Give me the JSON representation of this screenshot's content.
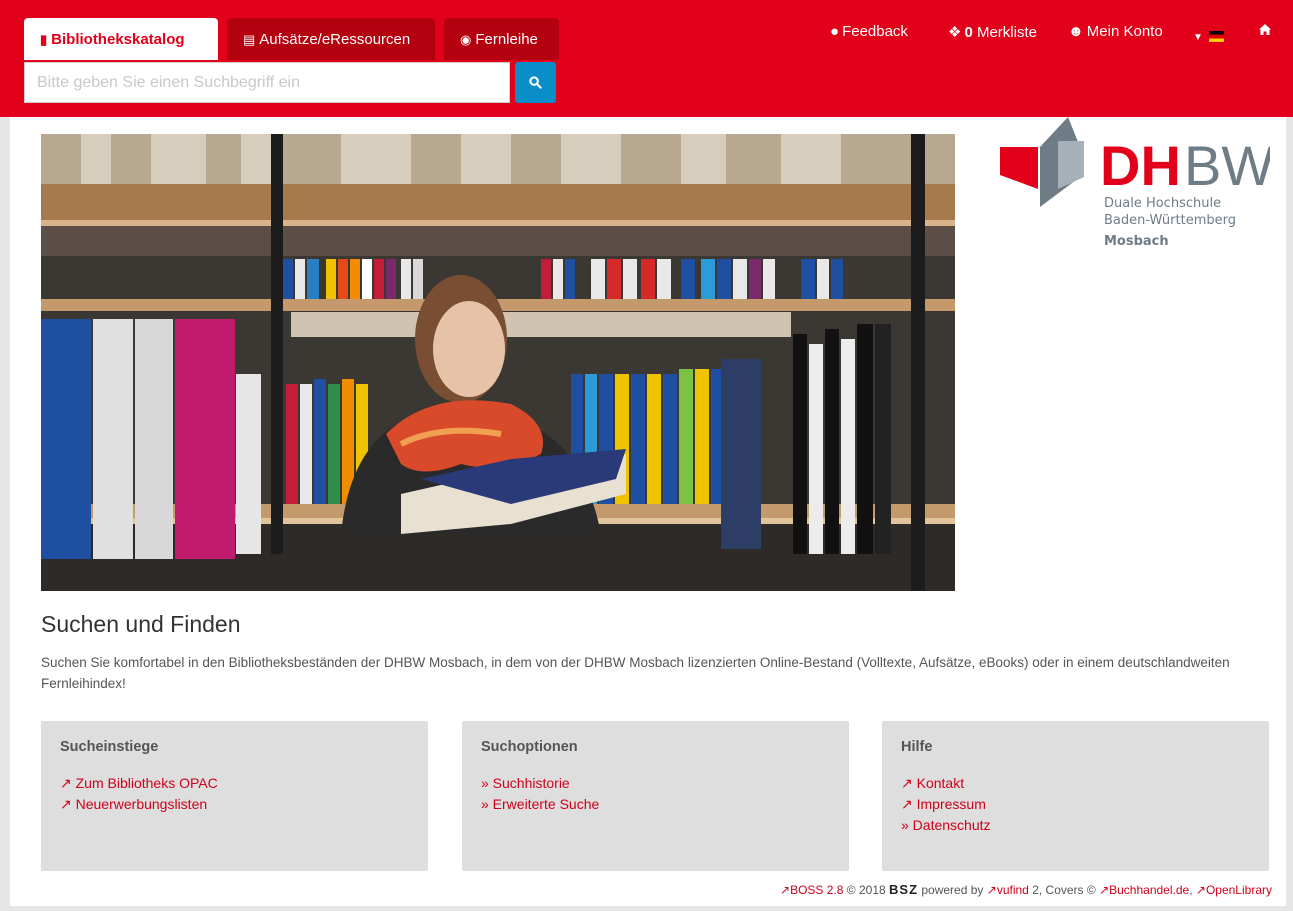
{
  "tabs": [
    {
      "label": "Bibliothekskatalog",
      "icon": "book-icon"
    },
    {
      "label": "Aufsätze/eRessourcen",
      "icon": "newspaper-icon"
    },
    {
      "label": "Fernleihe",
      "icon": "globe-icon"
    }
  ],
  "search": {
    "placeholder": "Bitte geben Sie einen Suchbegriff ein"
  },
  "topnav": {
    "feedback": "Feedback",
    "merkliste_count": "0",
    "merkliste": "Merkliste",
    "konto": "Mein Konto"
  },
  "logo": {
    "dh": "DH",
    "bw": "BW",
    "line1": "Duale Hochschule",
    "line2": "Baden-Württemberg",
    "line3": "Mosbach"
  },
  "intro": {
    "title": "Suchen und Finden",
    "text": "Suchen Sie komfortabel in den Bibliotheksbeständen der DHBW Mosbach, in dem von der DHBW Mosbach lizenzierten Online-Bestand (Volltexte, Aufsätze, eBooks) oder in einem deutschlandweiten Fernleihindex!"
  },
  "panels": {
    "sucheinstiege": {
      "title": "Sucheinstiege",
      "links": [
        "Zum Bibliotheks OPAC",
        "Neuerwerbungslisten"
      ]
    },
    "suchoptionen": {
      "title": "Suchoptionen",
      "links": [
        "» Suchhistorie",
        "» Erweiterte Suche"
      ]
    },
    "hilfe": {
      "title": "Hilfe",
      "links": [
        "Kontakt",
        "Impressum",
        "» Datenschutz"
      ]
    }
  },
  "footer": {
    "boss": "BOSS 2.8",
    "copyright": "© 2018",
    "bsz": "BSZ",
    "powered": "powered by",
    "vufind": "vufind",
    "vufind_ver": "2, Covers ©",
    "buchhandel": "Buchhandel.de",
    "sep": ",",
    "openlibrary": "OpenLibrary"
  },
  "colors": {
    "brand_red": "#e2001a",
    "search_blue": "#0a8ec9",
    "link_red": "#d0021b"
  }
}
